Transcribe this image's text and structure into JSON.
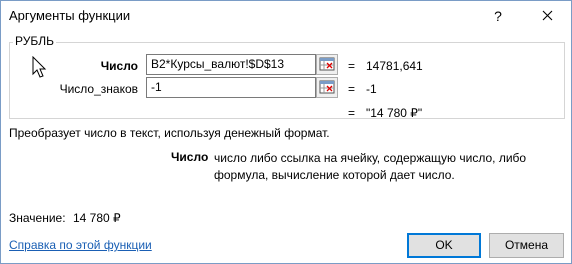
{
  "window": {
    "title": "Аргументы функции",
    "help_glyph": "?",
    "close_icon": "close-icon"
  },
  "function_group": {
    "name": "РУБЛЬ",
    "args": [
      {
        "label": "Число",
        "bold": true,
        "input": "B2*Курсы_валют!$D$13",
        "equals": "=",
        "value": "14781,641"
      },
      {
        "label": "Число_знаков",
        "bold": false,
        "input": "-1",
        "equals": "=",
        "value": "-1"
      }
    ],
    "result_equals": "=",
    "result_value": "\"14 780 ₽\""
  },
  "description": "Преобразует число в текст, используя денежный формат.",
  "arg_help": {
    "name": "Число",
    "text": "число либо ссылка на ячейку, содержащую число, либо формула, вычисление которой дает число."
  },
  "footer": {
    "result_label": "Значение:",
    "result_value": "14 780 ₽",
    "help_link": "Справка по этой функции",
    "ok_label": "OK",
    "cancel_label": "Отмена"
  },
  "colors": {
    "link": "#1a5fb4",
    "accent": "#0078d7",
    "border": "#7a9cc6"
  }
}
